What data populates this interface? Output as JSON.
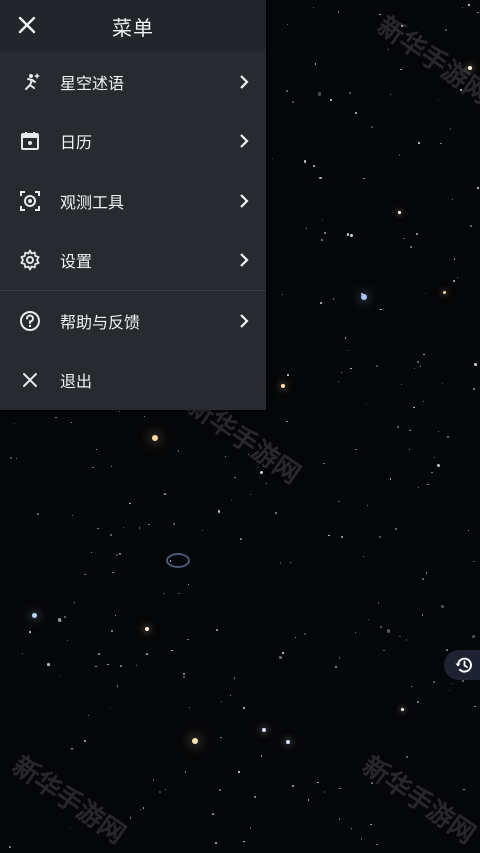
{
  "menu": {
    "title": "菜单",
    "items": [
      {
        "label": "星空述语",
        "icon": "runner-star-icon"
      },
      {
        "label": "日历",
        "icon": "calendar-icon"
      },
      {
        "label": "观测工具",
        "icon": "camera-tool-icon"
      },
      {
        "label": "设置",
        "icon": "gear-icon"
      },
      {
        "label": "帮助与反馈",
        "icon": "help-circle-icon"
      },
      {
        "label": "退出",
        "icon": "close-icon"
      }
    ]
  },
  "watermark": "新华手游网",
  "colors": {
    "sky": "#050608",
    "menu": "#272b30",
    "history_button": "#1f2233"
  }
}
